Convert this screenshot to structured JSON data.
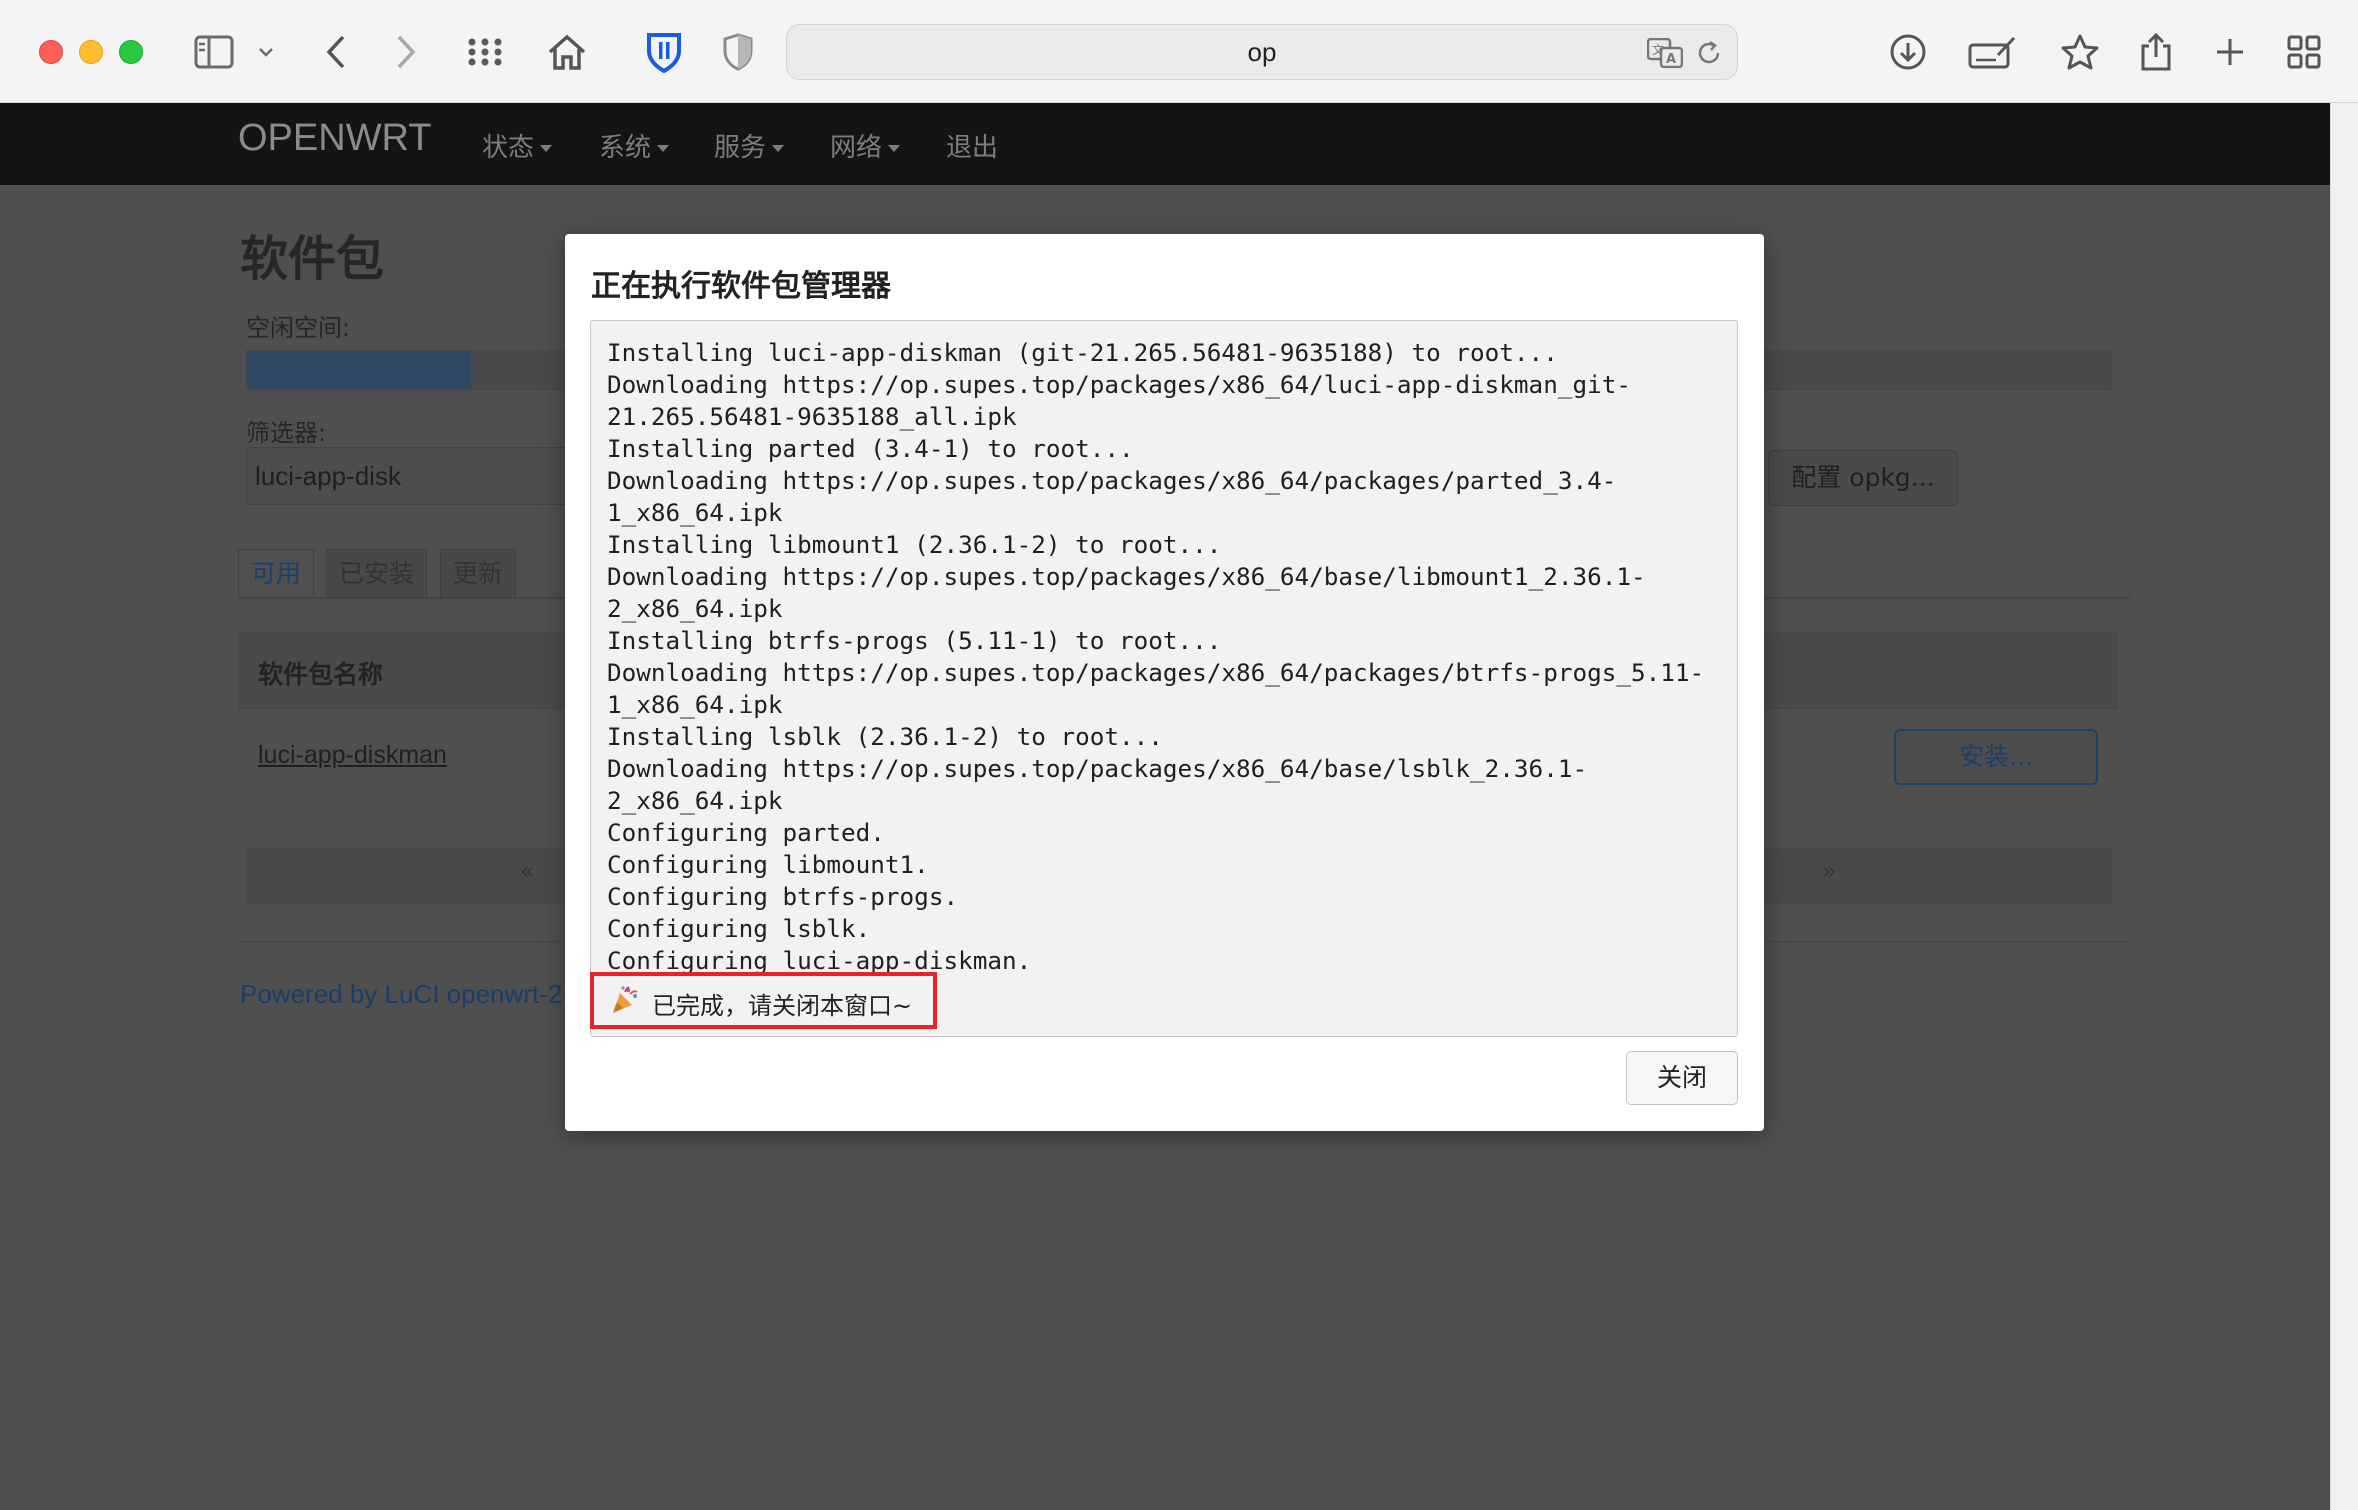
{
  "browser": {
    "url_text": "op",
    "icons": [
      "sidebar-icon",
      "chevron-down-icon",
      "back-icon",
      "forward-icon",
      "grid-icon",
      "home-icon",
      "bitwarden-shield-icon",
      "privacy-shield-icon",
      "translate-icon",
      "reload-icon",
      "download-icon",
      "signature-icon",
      "star-icon",
      "share-icon",
      "plus-icon",
      "tabs-overview-icon"
    ]
  },
  "nav": {
    "brand": "OPENWRT",
    "items": [
      {
        "label": "状态"
      },
      {
        "label": "系统"
      },
      {
        "label": "服务"
      },
      {
        "label": "网络"
      },
      {
        "label": "退出"
      }
    ]
  },
  "page": {
    "title": "软件包",
    "free_space_label": "空闲空间:",
    "free_space_fraction": 0.12,
    "filter_label": "筛选器:",
    "filter_value": "luci-app-disk",
    "config_button": "配置 opkg...",
    "tabs": [
      {
        "label": "可用"
      },
      {
        "label": "已安装"
      },
      {
        "label": "更新"
      }
    ],
    "table_header": "软件包名称",
    "package_name": "luci-app-diskman",
    "install_button": "安装...",
    "pager_prev": "«",
    "pager_next": "»",
    "footer": "Powered by LuCI openwrt-2"
  },
  "modal": {
    "title": "正在执行软件包管理器",
    "log_lines": [
      "Installing luci-app-diskman (git-21.265.56481-9635188) to root...",
      "Downloading https://op.supes.top/packages/x86_64/luci-app-diskman_git-",
      "21.265.56481-9635188_all.ipk",
      "Installing parted (3.4-1) to root...",
      "Downloading https://op.supes.top/packages/x86_64/packages/parted_3.4-",
      "1_x86_64.ipk",
      "Installing libmount1 (2.36.1-2) to root...",
      "Downloading https://op.supes.top/packages/x86_64/base/libmount1_2.36.1-",
      "2_x86_64.ipk",
      "Installing btrfs-progs (5.11-1) to root...",
      "Downloading https://op.supes.top/packages/x86_64/packages/btrfs-progs_5.11-",
      "1_x86_64.ipk",
      "Installing lsblk (2.36.1-2) to root...",
      "Downloading https://op.supes.top/packages/x86_64/base/lsblk_2.36.1-",
      "2_x86_64.ipk",
      "Configuring parted.",
      "Configuring libmount1.",
      "Configuring btrfs-progs.",
      "Configuring lsblk.",
      "Configuring luci-app-diskman."
    ],
    "done_icon": "party-popper-icon",
    "done_text": "已完成，请关闭本窗口~",
    "close_button": "关闭"
  },
  "colors": {
    "highlight_box": "#e3242b",
    "link_blue": "#19426a",
    "navbar": "#141414"
  }
}
